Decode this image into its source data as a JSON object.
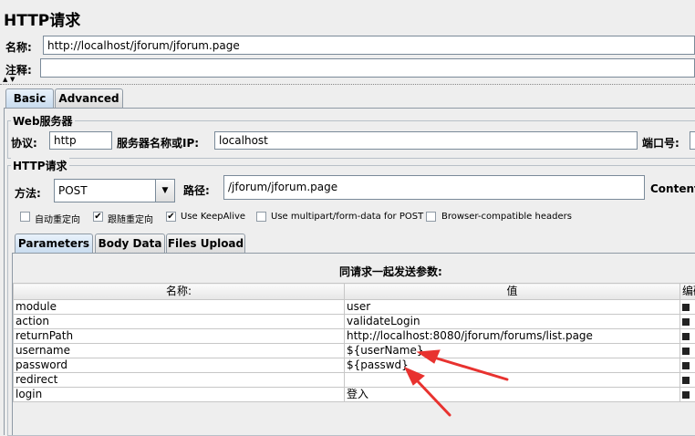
{
  "window": {
    "title": "HTTP请求"
  },
  "name_row": {
    "label": "名称:",
    "value": "http://localhost/jforum/jforum.page"
  },
  "comment_row": {
    "label": "注释:",
    "value": ""
  },
  "tabs": [
    {
      "label": "Basic"
    },
    {
      "label": "Advanced"
    }
  ],
  "web_server": {
    "title": "Web服务器",
    "protocol_label": "协议:",
    "protocol_value": "http",
    "server_label": "服务器名称或IP:",
    "server_value": "localhost",
    "port_label": "端口号:"
  },
  "http_request": {
    "title": "HTTP请求",
    "method_label": "方法:",
    "method_value": "POST",
    "path_label": "路径:",
    "path_value": "/jforum/jforum.page",
    "content_label": "Content e"
  },
  "options": [
    {
      "label": "自动重定向",
      "checked": false
    },
    {
      "label": "跟随重定向",
      "checked": true
    },
    {
      "label": "Use KeepAlive",
      "checked": true
    },
    {
      "label": "Use multipart/form-data for POST",
      "checked": false
    },
    {
      "label": "Browser-compatible headers",
      "checked": false
    }
  ],
  "sub_tabs": [
    {
      "label": "Parameters"
    },
    {
      "label": "Body Data"
    },
    {
      "label": "Files Upload"
    }
  ],
  "params": {
    "heading": "同请求一起发送参数:",
    "columns": [
      "名称:",
      "值",
      "编码"
    ],
    "rows": [
      {
        "name": "module",
        "value": "user"
      },
      {
        "name": "action",
        "value": "validateLogin"
      },
      {
        "name": "returnPath",
        "value": "http://localhost:8080/jforum/forums/list.page"
      },
      {
        "name": "username",
        "value": "${userName}"
      },
      {
        "name": "password",
        "value": "${passwd}"
      },
      {
        "name": "redirect",
        "value": ""
      },
      {
        "name": "login",
        "value": "登入"
      }
    ]
  },
  "colors": {
    "arrow": "#e8322f",
    "tab_active": "#c9dcef"
  }
}
